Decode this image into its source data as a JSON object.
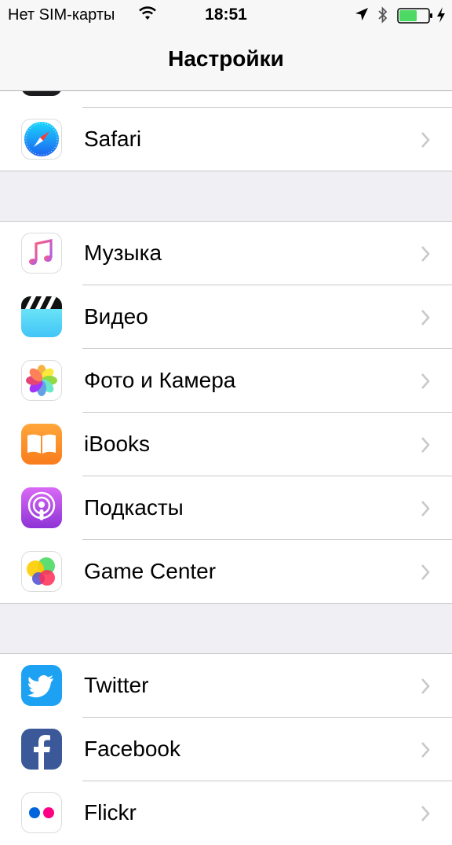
{
  "status_bar": {
    "carrier": "Нет SIM-карты",
    "time": "18:51",
    "icons": [
      "wifi-icon",
      "location-arrow-icon",
      "bluetooth-icon",
      "battery-icon",
      "charging-bolt-icon"
    ],
    "battery_color": "#4cd964"
  },
  "nav": {
    "title": "Настройки"
  },
  "rows": [
    {
      "label": "Safari",
      "icon": "safari-icon"
    },
    {
      "label": "Музыка",
      "icon": "music-icon"
    },
    {
      "label": "Видео",
      "icon": "video-icon"
    },
    {
      "label": "Фото и Камера",
      "icon": "photos-camera-icon"
    },
    {
      "label": "iBooks",
      "icon": "ibooks-icon"
    },
    {
      "label": "Подкасты",
      "icon": "podcasts-icon"
    },
    {
      "label": "Game Center",
      "icon": "game-center-icon"
    },
    {
      "label": "Twitter",
      "icon": "twitter-icon"
    },
    {
      "label": "Facebook",
      "icon": "facebook-icon"
    },
    {
      "label": "Flickr",
      "icon": "flickr-icon"
    }
  ],
  "colors": {
    "background": "#efeff4",
    "separator": "#c8c7cc",
    "chevron": "#c7c7cc"
  }
}
